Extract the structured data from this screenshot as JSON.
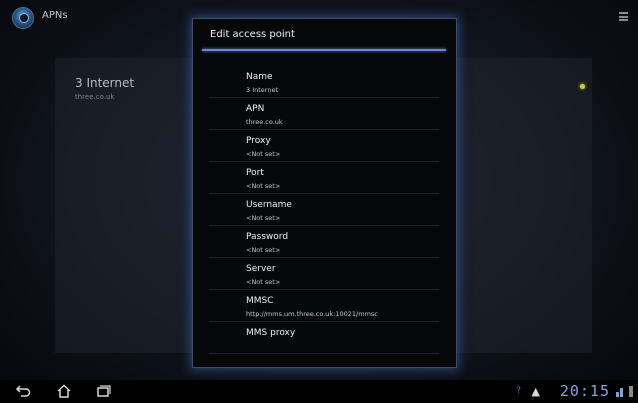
{
  "action_bar": {
    "title": "APNs",
    "app_icon": "settings-globe-icon",
    "menu_icon": "overflow-menu-icon"
  },
  "apn_list": {
    "items": [
      {
        "name": "3 Internet",
        "apn": "three.co.uk",
        "selected": true
      }
    ]
  },
  "dialog": {
    "title": "Edit access point",
    "fields": [
      {
        "label": "Name",
        "value": "3 Internet"
      },
      {
        "label": "APN",
        "value": "three.co.uk"
      },
      {
        "label": "Proxy",
        "value": "<Not set>"
      },
      {
        "label": "Port",
        "value": "<Not set>"
      },
      {
        "label": "Username",
        "value": "<Not set>"
      },
      {
        "label": "Password",
        "value": "<Not set>"
      },
      {
        "label": "Server",
        "value": "<Not set>"
      },
      {
        "label": "MMSC",
        "value": "http://mms.um.three.co.uk:10021/mmsc"
      },
      {
        "label": "MMS proxy",
        "value": ""
      }
    ]
  },
  "system_bar": {
    "clock": "20:15",
    "status_q": "?",
    "status_warning": "▲",
    "icons": [
      "back-icon",
      "home-icon",
      "recent-apps-icon",
      "warning-icon",
      "signal-icon",
      "battery-icon"
    ]
  },
  "colors": {
    "accent": "#6f86d8",
    "clock": "#7fa6e0",
    "radio": "#c7d23b"
  }
}
